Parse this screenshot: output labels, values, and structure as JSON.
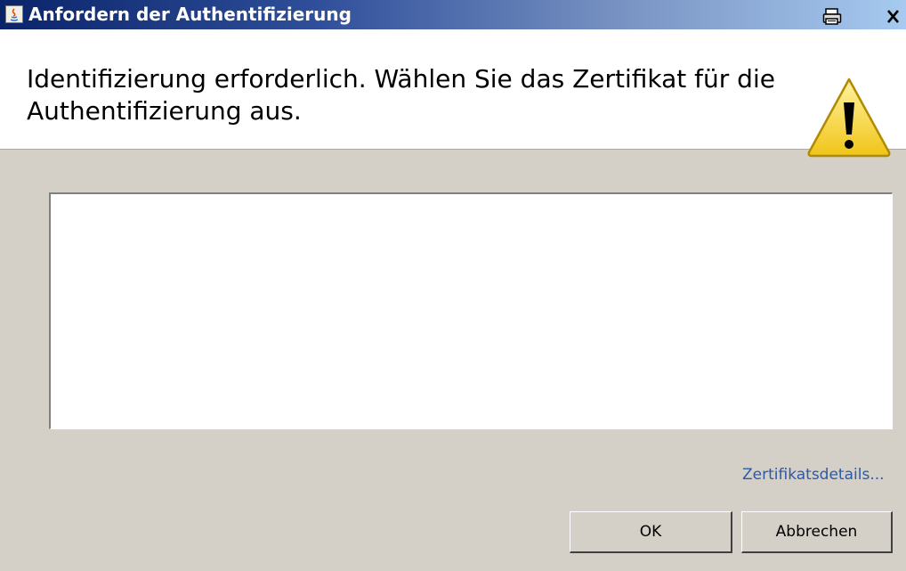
{
  "window": {
    "title": "Anfordern der Authentifizierung",
    "app_icon": "java-icon",
    "buttons": [
      {
        "name": "print-icon"
      },
      {
        "name": "close-icon",
        "label": "×"
      }
    ]
  },
  "header": {
    "message": "Identifizierung erforderlich.  Wählen Sie das Zertifikat für die Authentifizierung aus.",
    "icon": "warning-icon"
  },
  "certificate_list": {
    "items": []
  },
  "details_link": "Zertifikatsdetails...",
  "buttons": {
    "ok": "OK",
    "cancel": "Abbrechen"
  },
  "colors": {
    "titlebar_start": "#0a246a",
    "titlebar_end": "#a6caf0",
    "dialog_bg": "#d4d0c8",
    "link": "#2b5aa8",
    "warning": "#f5d21a"
  }
}
